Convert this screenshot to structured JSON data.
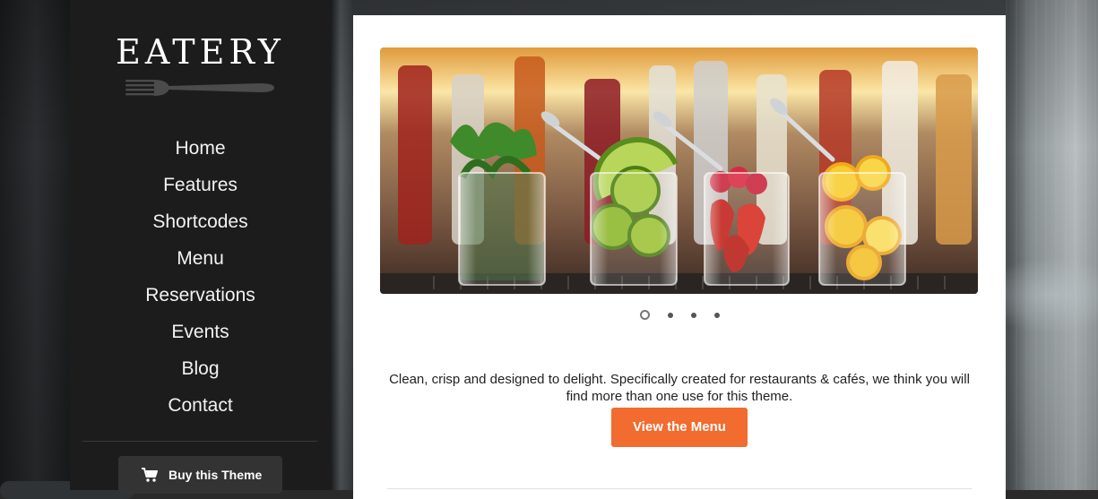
{
  "brand": {
    "logo_text": "EATERY",
    "logo_icon": "fork-icon"
  },
  "nav": {
    "items": [
      {
        "label": "Home"
      },
      {
        "label": "Features"
      },
      {
        "label": "Shortcodes"
      },
      {
        "label": "Menu"
      },
      {
        "label": "Reservations"
      },
      {
        "label": "Events"
      },
      {
        "label": "Blog"
      },
      {
        "label": "Contact"
      }
    ]
  },
  "sidebar": {
    "buy_button": {
      "label": "Buy this Theme",
      "icon": "cart-icon"
    }
  },
  "slider": {
    "image": "bar-drinks-garnish-glasses",
    "slide_count": 4,
    "active_slide": 1
  },
  "content": {
    "intro_text": "Clean, crisp and designed to delight. Specifically created for restaurants & cafés, we think you will find more than one use for this theme.",
    "cta_label": "View the Menu"
  },
  "colors": {
    "accent": "#f26b2f",
    "sidebar_bg": "#1c1c1c",
    "buy_button_bg": "#333333"
  }
}
